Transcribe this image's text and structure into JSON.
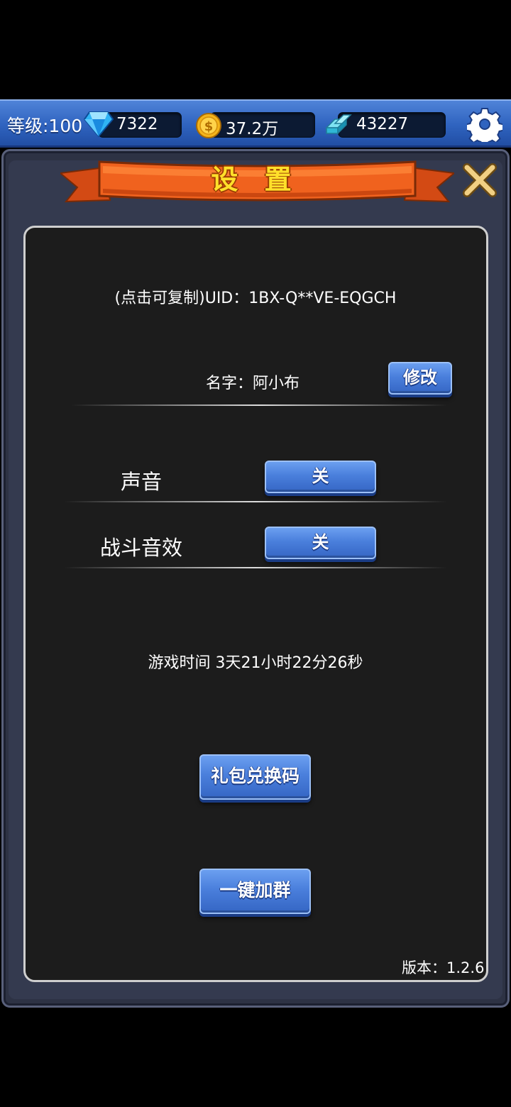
{
  "topbar": {
    "level_text": "等级:100",
    "gems": "7322",
    "gold": "37.2万",
    "crystals": "43227"
  },
  "panel": {
    "title": "设 置",
    "uid_text": "(点击可复制)UID：1BX-Q**VE-EQGCH",
    "name_text": "名字：阿小布",
    "edit_button": "修改",
    "sound_label": "声音",
    "sound_toggle": "关",
    "battle_sfx_label": "战斗音效",
    "battle_sfx_toggle": "关",
    "playtime_text": "游戏时间 3天21小时22分26秒",
    "gift_code_button": "礼包兑换码",
    "join_group_button": "一键加群",
    "version_text": "版本：1.2.6"
  },
  "colors": {
    "topbar_blue": "#3a6fcc",
    "ribbon_orange": "#f0621e",
    "title_yellow": "#ffe02a",
    "button_blue": "#4a7fdc",
    "content_bg": "#1c1c1c",
    "frame": "#2d3244"
  },
  "icons": [
    "gem-icon",
    "gold-coin-icon",
    "crystal-icon",
    "gear-icon",
    "close-icon"
  ]
}
